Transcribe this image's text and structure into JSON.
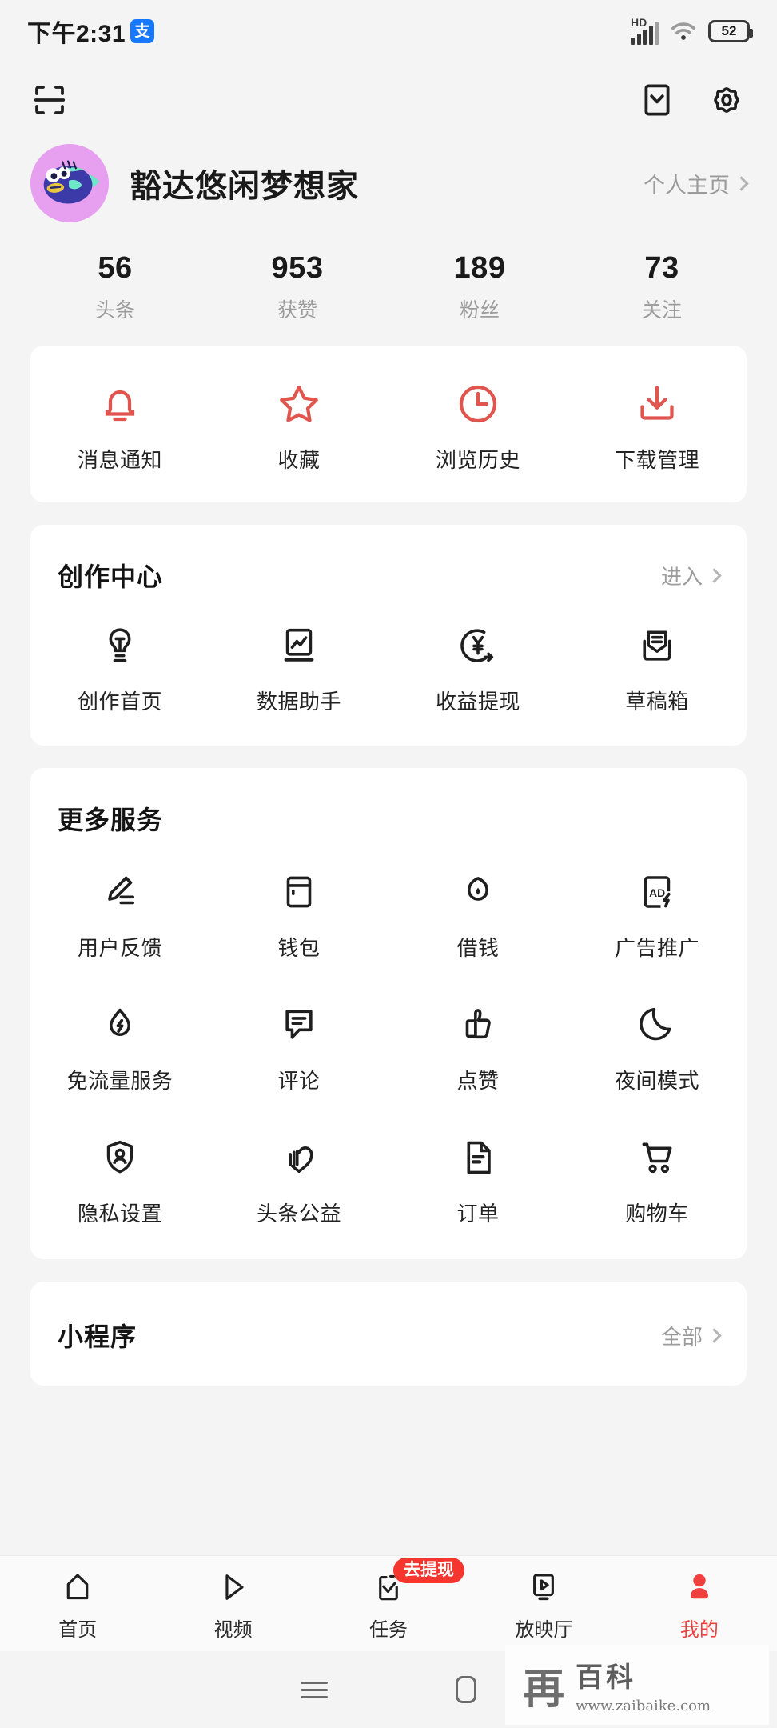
{
  "status_bar": {
    "time": "下午2:31",
    "alipay_glyph": "支",
    "network_label": "HD",
    "battery_level": "52",
    "icons": [
      "alipay-icon",
      "signal-bars-icon",
      "wifi-icon",
      "battery-icon"
    ]
  },
  "top_bar": {
    "scan_icon": "scan-qr-icon",
    "mail_icon": "mail-icon",
    "settings_icon": "gear-icon"
  },
  "profile": {
    "username": "豁达悠闲梦想家",
    "home_link": "个人主页",
    "avatar_icon": "fish-avatar",
    "stats": [
      {
        "value": "56",
        "label": "头条"
      },
      {
        "value": "953",
        "label": "获赞"
      },
      {
        "value": "189",
        "label": "粉丝"
      },
      {
        "value": "73",
        "label": "关注"
      }
    ]
  },
  "quick_actions": [
    {
      "label": "消息通知",
      "icon": "bell-icon"
    },
    {
      "label": "收藏",
      "icon": "star-icon"
    },
    {
      "label": "浏览历史",
      "icon": "clock-icon"
    },
    {
      "label": "下载管理",
      "icon": "download-icon"
    }
  ],
  "creator_center": {
    "title": "创作中心",
    "more_label": "进入",
    "items": [
      {
        "label": "创作首页",
        "icon": "lightbulb-icon"
      },
      {
        "label": "数据助手",
        "icon": "chart-icon"
      },
      {
        "label": "收益提现",
        "icon": "yen-withdraw-icon"
      },
      {
        "label": "草稿箱",
        "icon": "drafts-inbox-icon"
      }
    ]
  },
  "more_services": {
    "title": "更多服务",
    "rows": [
      [
        {
          "label": "用户反馈",
          "icon": "pencil-feedback-icon"
        },
        {
          "label": "钱包",
          "icon": "wallet-icon"
        },
        {
          "label": "借钱",
          "icon": "loan-icon"
        },
        {
          "label": "广告推广",
          "icon": "ad-promote-icon"
        }
      ],
      [
        {
          "label": "免流量服务",
          "icon": "data-free-droplet-icon"
        },
        {
          "label": "评论",
          "icon": "comment-icon"
        },
        {
          "label": "点赞",
          "icon": "thumbs-up-icon"
        },
        {
          "label": "夜间模式",
          "icon": "moon-icon"
        }
      ],
      [
        {
          "label": "隐私设置",
          "icon": "shield-person-icon"
        },
        {
          "label": "头条公益",
          "icon": "charity-heart-icon"
        },
        {
          "label": "订单",
          "icon": "document-icon"
        },
        {
          "label": "购物车",
          "icon": "shopping-cart-icon"
        }
      ]
    ]
  },
  "mini_programs": {
    "title": "小程序",
    "more_label": "全部"
  },
  "tab_bar": {
    "items": [
      {
        "label": "首页",
        "icon": "home-icon",
        "active": false,
        "badge": ""
      },
      {
        "label": "视频",
        "icon": "play-icon",
        "active": false,
        "badge": ""
      },
      {
        "label": "任务",
        "icon": "task-check-icon",
        "active": false,
        "badge": "去提现"
      },
      {
        "label": "放映厅",
        "icon": "cinema-icon",
        "active": false,
        "badge": ""
      },
      {
        "label": "我的",
        "icon": "person-icon",
        "active": true,
        "badge": ""
      }
    ]
  },
  "android_nav": {
    "menu_icon": "menu-icon",
    "home_icon": "home-pill-icon"
  },
  "watermark": {
    "seal": "再",
    "name": "百科",
    "url": "www.zaibaike.com"
  },
  "colors": {
    "accent_red": "#ef3f3f",
    "quick_icon_red": "#e0564f",
    "page_bg": "#f4f4f4",
    "card_bg": "#ffffff",
    "avatar_bg": "#e79ff0"
  }
}
